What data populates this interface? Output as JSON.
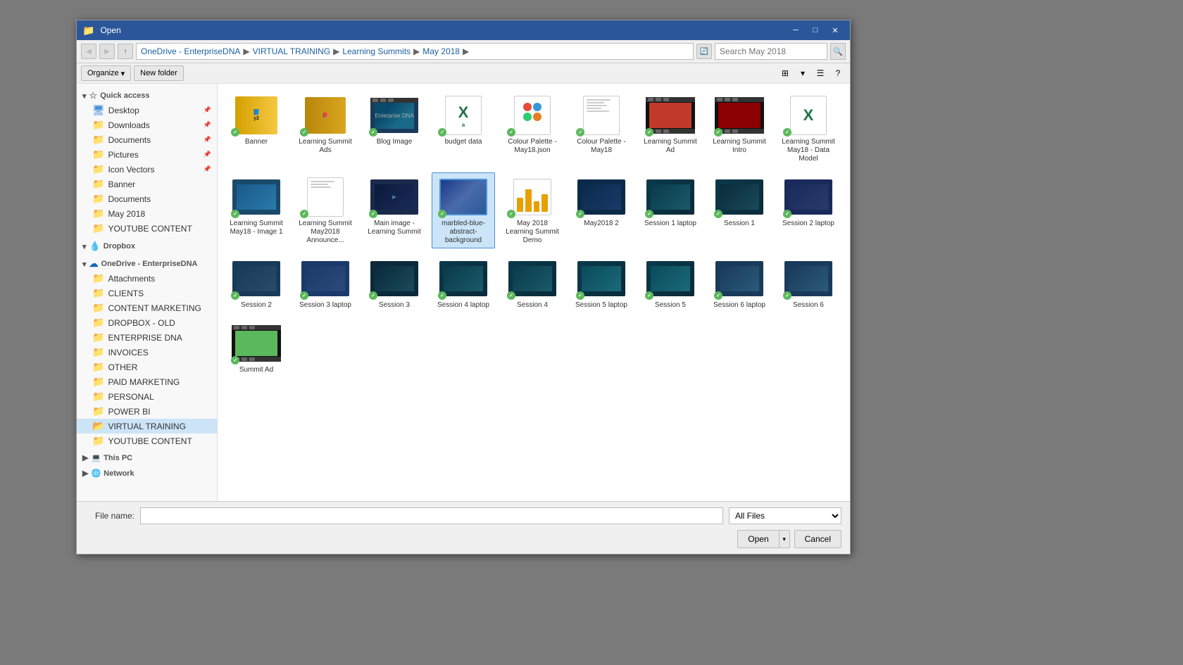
{
  "dialog": {
    "title": "Open",
    "title_icon": "📁"
  },
  "address": {
    "breadcrumb": [
      "OneDrive - EnterpriseDNA",
      "VIRTUAL TRAINING",
      "Learning Summits",
      "May 2018"
    ],
    "search_placeholder": "Search May 2018"
  },
  "toolbar": {
    "organize_label": "Organize",
    "new_folder_label": "New folder"
  },
  "sidebar": {
    "quick_access_label": "Quick access",
    "items_quick": [
      {
        "label": "Desktop",
        "icon": "desktop"
      },
      {
        "label": "Downloads",
        "icon": "folder"
      },
      {
        "label": "Documents",
        "icon": "folder"
      },
      {
        "label": "Pictures",
        "icon": "folder"
      },
      {
        "label": "Icon Vectors",
        "icon": "folder"
      },
      {
        "label": "Banner",
        "icon": "folder"
      },
      {
        "label": "Documents",
        "icon": "folder"
      },
      {
        "label": "May 2018",
        "icon": "folder"
      },
      {
        "label": "YOUTUBE CONTENT",
        "icon": "folder"
      }
    ],
    "dropbox_label": "Dropbox",
    "onedrive_label": "OneDrive - EnterpriseDNA",
    "items_onedrive": [
      {
        "label": "Attachments",
        "icon": "folder"
      },
      {
        "label": "CLIENTS",
        "icon": "folder"
      },
      {
        "label": "CONTENT MARKETING",
        "icon": "folder"
      },
      {
        "label": "DROPBOX - OLD",
        "icon": "folder"
      },
      {
        "label": "ENTERPRISE DNA",
        "icon": "folder"
      },
      {
        "label": "INVOICES",
        "icon": "folder"
      },
      {
        "label": "OTHER",
        "icon": "folder"
      },
      {
        "label": "PAID MARKETING",
        "icon": "folder"
      },
      {
        "label": "PERSONAL",
        "icon": "folder"
      },
      {
        "label": "POWER BI",
        "icon": "folder"
      },
      {
        "label": "VIRTUAL TRAINING",
        "icon": "folder",
        "selected": true
      },
      {
        "label": "YOUTUBE CONTENT",
        "icon": "folder"
      }
    ],
    "this_pc_label": "This PC",
    "network_label": "Network"
  },
  "files": [
    {
      "name": "Banner",
      "type": "book_yellow",
      "checked": true
    },
    {
      "name": "Learning Summit Ads",
      "type": "book_gold",
      "checked": true
    },
    {
      "name": "Blog Image",
      "type": "screen_teal",
      "checked": true
    },
    {
      "name": "budget data",
      "type": "excel",
      "checked": true
    },
    {
      "name": "Colour Palette - May18.json",
      "type": "json",
      "checked": true
    },
    {
      "name": "Colour Palette - May18",
      "type": "doc",
      "checked": true
    },
    {
      "name": "Learning Summit Ad",
      "type": "red_video",
      "checked": true
    },
    {
      "name": "Learning Summit Intro",
      "type": "red_video2",
      "checked": true
    },
    {
      "name": "Learning Summit May18 - Data Model",
      "type": "excel2",
      "checked": true
    },
    {
      "name": "Learning Summit May18 - Image 1",
      "type": "screen_blue2",
      "checked": true
    },
    {
      "name": "Learning Summit May2018 Announce...",
      "type": "doc2",
      "checked": true
    },
    {
      "name": "Main image - Learning Summit",
      "type": "screen_dark",
      "checked": true
    },
    {
      "name": "marbled-blue-abstract-background",
      "type": "img_blue",
      "checked": true,
      "selected": true
    },
    {
      "name": "May 2018 Learning Summit Demo",
      "type": "chart",
      "checked": true
    },
    {
      "name": "May2018 2",
      "type": "screen_dark2",
      "checked": true
    },
    {
      "name": "Session 1 laptop",
      "type": "screen_teal2",
      "checked": true
    },
    {
      "name": "Session 1",
      "type": "screen_teal3",
      "checked": true
    },
    {
      "name": "Session 2 laptop",
      "type": "screen_teal4",
      "checked": true
    },
    {
      "name": "Session 2",
      "type": "screen_teal5",
      "checked": true
    },
    {
      "name": "Session 3 laptop",
      "type": "screen_teal6",
      "checked": true
    },
    {
      "name": "Session 3",
      "type": "screen_teal7",
      "checked": true
    },
    {
      "name": "Session 4 laptop",
      "type": "screen_teal8",
      "checked": true
    },
    {
      "name": "Session 4",
      "type": "screen_teal9",
      "checked": true
    },
    {
      "name": "Session 5 laptop",
      "type": "screen_teal10",
      "checked": true
    },
    {
      "name": "Session 5",
      "type": "screen_teal11",
      "checked": true
    },
    {
      "name": "Session 6 laptop",
      "type": "screen_teal12",
      "checked": true
    },
    {
      "name": "Session 6",
      "type": "screen_teal13",
      "checked": true
    },
    {
      "name": "Summit Ad",
      "type": "green_film",
      "checked": true
    }
  ],
  "bottom": {
    "filename_label": "File name:",
    "filename_value": "",
    "filetype_label": "All Files",
    "open_label": "Open",
    "cancel_label": "Cancel"
  }
}
